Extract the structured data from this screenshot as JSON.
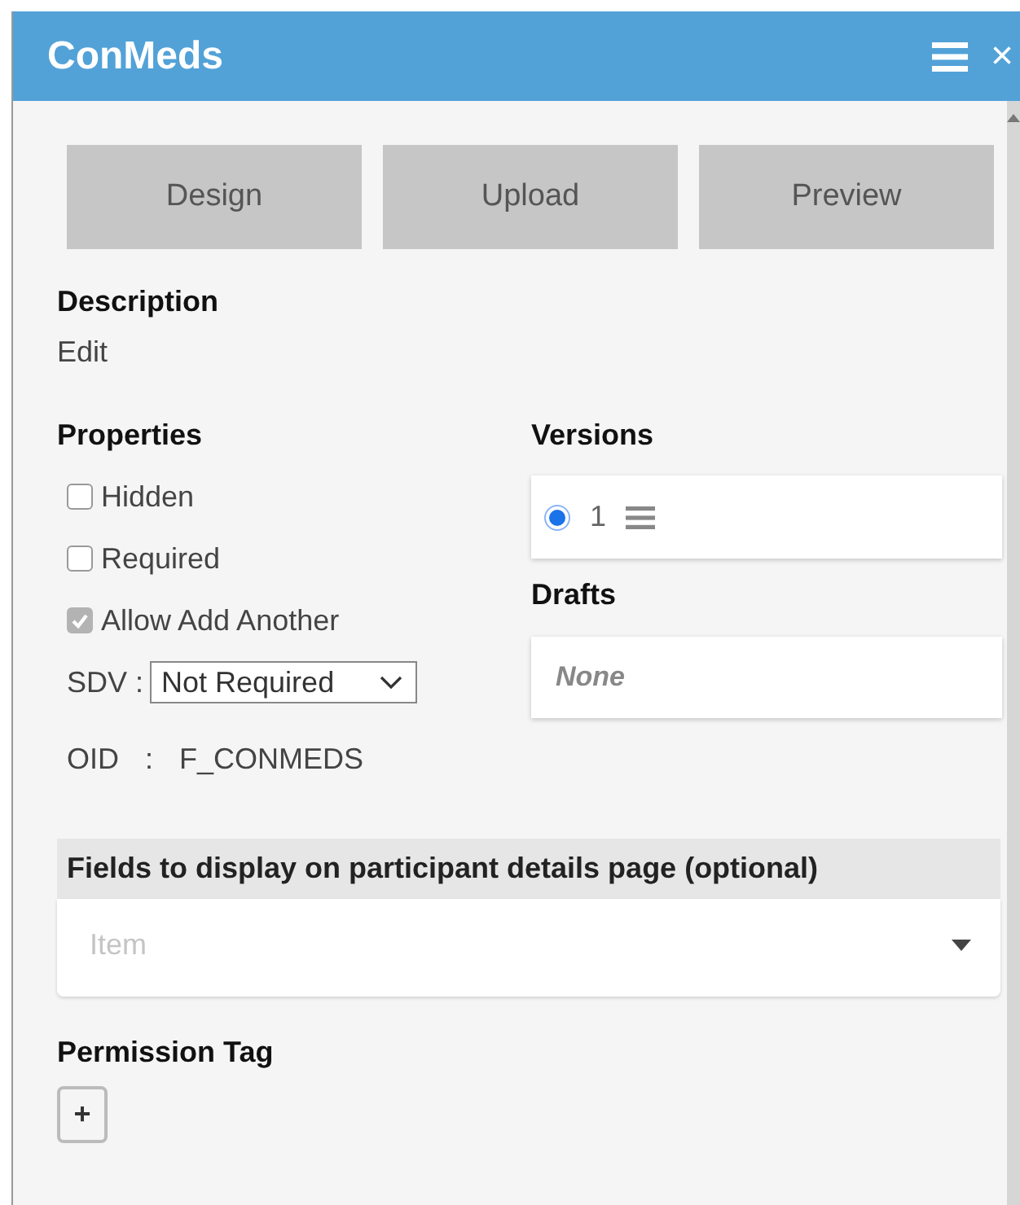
{
  "window": {
    "title": "ConMeds",
    "close": "×"
  },
  "buttons": [
    "Design",
    "Upload",
    "Preview"
  ],
  "description": {
    "label": "Description",
    "value": "Edit"
  },
  "properties": {
    "label": "Properties",
    "checkboxes": [
      {
        "label": "Hidden",
        "checked": false
      },
      {
        "label": "Required",
        "checked": false
      },
      {
        "label": "Allow Add Another",
        "checked": true
      }
    ],
    "sdv": {
      "label": "SDV :",
      "value": "Not Required"
    },
    "oid": {
      "label": "OID",
      "separator": ":",
      "value": "F_CONMEDS"
    }
  },
  "versions": {
    "label": "Versions",
    "items": [
      {
        "label": "1",
        "selected": true
      }
    ]
  },
  "drafts": {
    "label": "Drafts",
    "value": "None"
  },
  "fields": {
    "label": "Fields to display on participant details page (optional)",
    "placeholder": "Item"
  },
  "permission_tag": {
    "label": "Permission Tag",
    "add": "+"
  }
}
